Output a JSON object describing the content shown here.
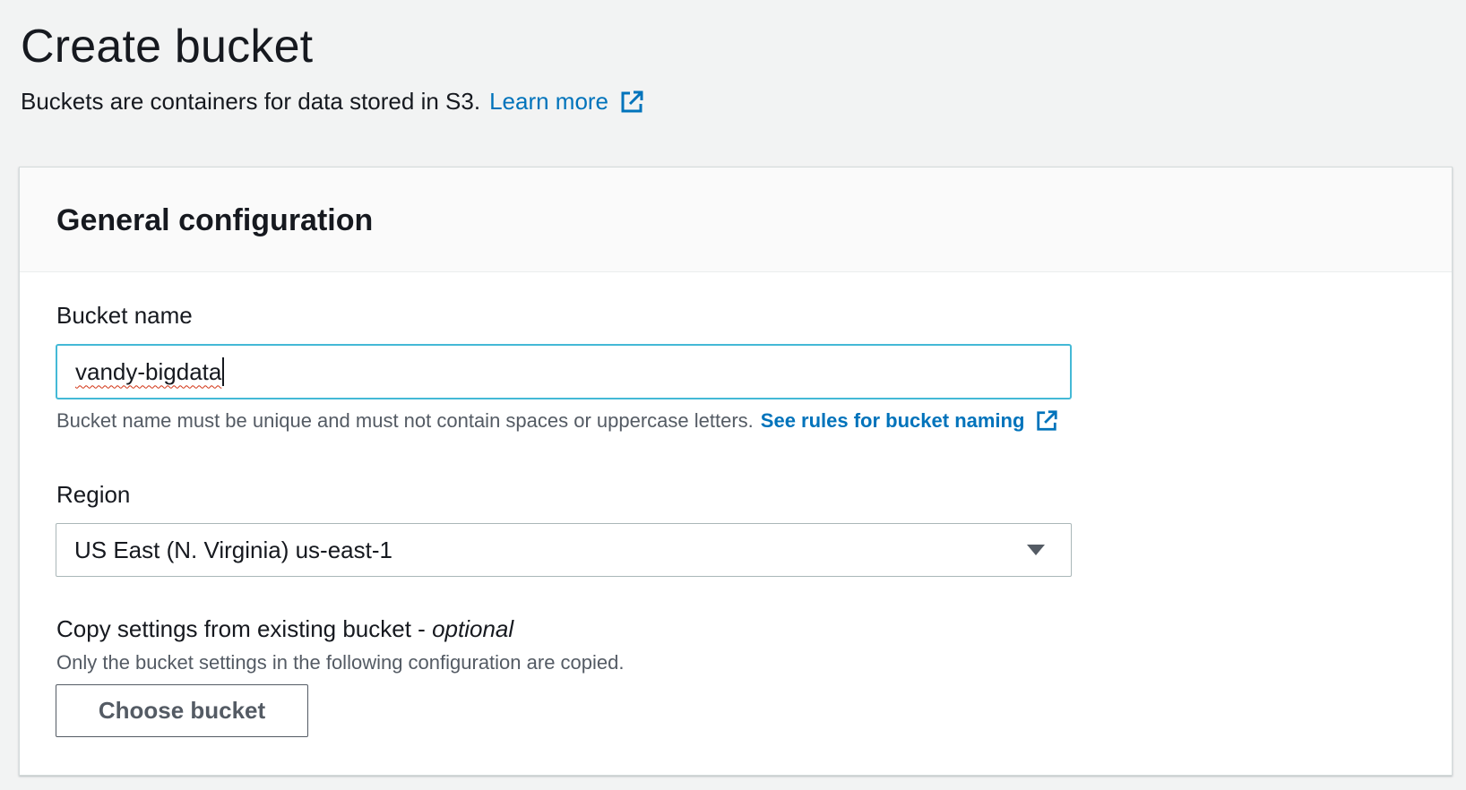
{
  "page": {
    "title": "Create bucket",
    "description": "Buckets are containers for data stored in S3.",
    "learn_more": "Learn more",
    "link_color": "#0073bb"
  },
  "panel": {
    "title": "General configuration",
    "bucket_name": {
      "label": "Bucket name",
      "value": "vandy-bigdata",
      "hint": "Bucket name must be unique and must not contain spaces or uppercase letters.",
      "rules_link": "See rules for bucket naming",
      "focus_color": "#44b9d6"
    },
    "region": {
      "label": "Region",
      "selected": "US East (N. Virginia) us-east-1",
      "icon": "caret-down-icon"
    },
    "copy_settings": {
      "label": "Copy settings from existing bucket - ",
      "label_optional": "optional",
      "description": "Only the bucket settings in the following configuration are copied.",
      "button": "Choose bucket"
    }
  },
  "icons": {
    "external_link": "external-link-icon"
  }
}
